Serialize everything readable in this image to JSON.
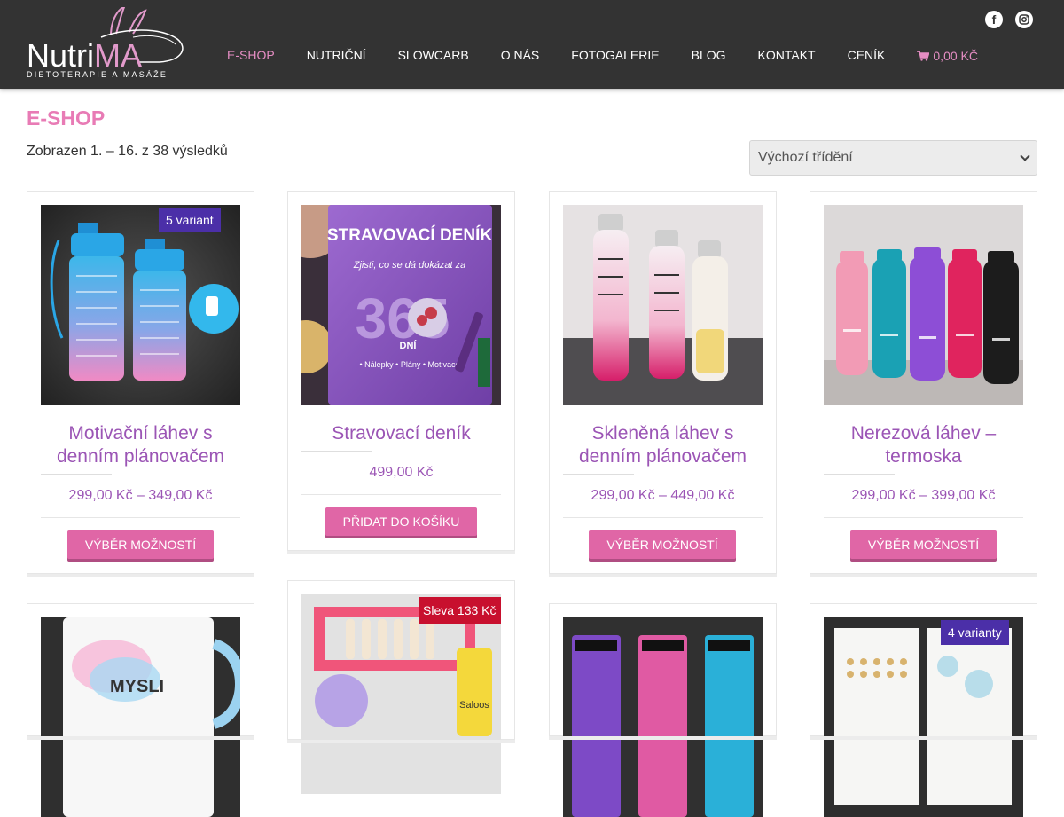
{
  "header": {
    "logo": {
      "name": "Nutri",
      "name_accent": "MA",
      "tagline": "DIETOTERAPIE A MASÁŽE"
    },
    "nav": [
      {
        "label": "E-SHOP",
        "active": true
      },
      {
        "label": "NUTRIČNÍ"
      },
      {
        "label": "SLOWCARB"
      },
      {
        "label": "O NÁS"
      },
      {
        "label": "FOTOGALERIE"
      },
      {
        "label": "BLOG"
      },
      {
        "label": "KONTAKT"
      },
      {
        "label": "CENÍK"
      }
    ],
    "cart_total": "0,00 Kč",
    "social": {
      "facebook_icon": "f",
      "instagram_icon": "instagram"
    }
  },
  "main": {
    "title": "E-SHOP",
    "result_count": "Zobrazen 1. – 16. z 38 výsledků",
    "sort": {
      "selected": "Výchozí třídění"
    }
  },
  "products": [
    {
      "title": "Motivační láhev s denním plánovačem",
      "price": "299,00 Kč – 349,00 Kč",
      "button": "VÝBĚR MOŽNOSTÍ",
      "badge": "5 variant"
    },
    {
      "title": "Stravovací deník",
      "price": "499,00 Kč",
      "button": "PŘIDAT DO KOŠÍKU",
      "image_text": {
        "title": "STRAVOVACÍ DENÍK",
        "subtitle": "Zjisti, co se dá dokázat za",
        "number": "365",
        "days": "DNÍ",
        "features": "• Nálepky • Plány • Motivace"
      }
    },
    {
      "title": "Skleněná láhev s denním plánovačem",
      "price": "299,00 Kč – 449,00 Kč",
      "button": "VÝBĚR MOŽNOSTÍ"
    },
    {
      "title": "Nerezová láhev – termoska",
      "price": "299,00 Kč – 399,00 Kč",
      "button": "VÝBĚR MOŽNOSTÍ"
    },
    {
      "image_text": {
        "line1": "MYSLI"
      }
    },
    {
      "badge": "Sleva 133 Kč",
      "image_text": {
        "label": "Saloos"
      }
    },
    {},
    {
      "badge": "4 varianty"
    }
  ],
  "colors": {
    "header_bg": "#333333",
    "accent_pink": "#e87bb5",
    "title_purple": "#9b55b5",
    "button_pink": "#e066a6",
    "badge_purple": "#4b2fa8",
    "badge_sale": "#c8102e"
  }
}
